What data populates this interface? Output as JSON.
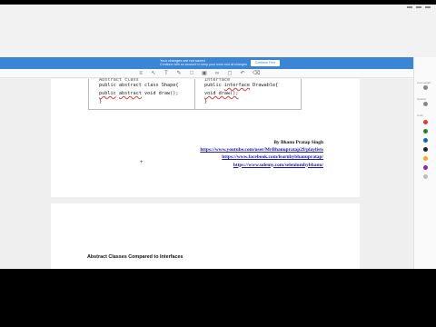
{
  "banner": {
    "line1": "Your changes are not saved",
    "line2": "Continue with an account to keep your work and all changes",
    "button": "Continue Free"
  },
  "toolbar": {
    "icons": [
      "menu-icon",
      "pointer-icon",
      "text-icon",
      "pen-icon",
      "shape-icon",
      "image-icon",
      "link-icon",
      "comment-icon",
      "undo-icon",
      "trash-icon"
    ]
  },
  "document": {
    "left_cell": {
      "cut_line": "Abstract class",
      "line1": "public abstract class Shape{",
      "line2_kw": "public",
      "line2_kw2": "abstract",
      "line2_rest": " void draw();",
      "line3": "}"
    },
    "right_cell": {
      "cut_line": "Interface",
      "line1_a": "public ",
      "line1_kw": "interface",
      "line1_b": " Drawable{",
      "line2_kw": "void draw();",
      "line3": "}"
    },
    "author": {
      "name": "By Bhanu Pratap Singh",
      "links": [
        "https://www.youtube.com/user/MrBhanupratap29/playlists",
        "https://www.facebook.com/learnbybhanupratap/",
        "https://www.udemy.com/seleniumbybhanu/"
      ]
    },
    "page2_heading": "Abstract Classes Compared to Interfaces"
  },
  "side_panel": {
    "labels": [
      "Line weight",
      "Opacity",
      "Color"
    ],
    "colors": [
      "#888888",
      "#e53935",
      "#2e7d32",
      "#1565c0",
      "#212121",
      "#f9a825",
      "#8e24aa",
      "#bdbdbd"
    ]
  }
}
